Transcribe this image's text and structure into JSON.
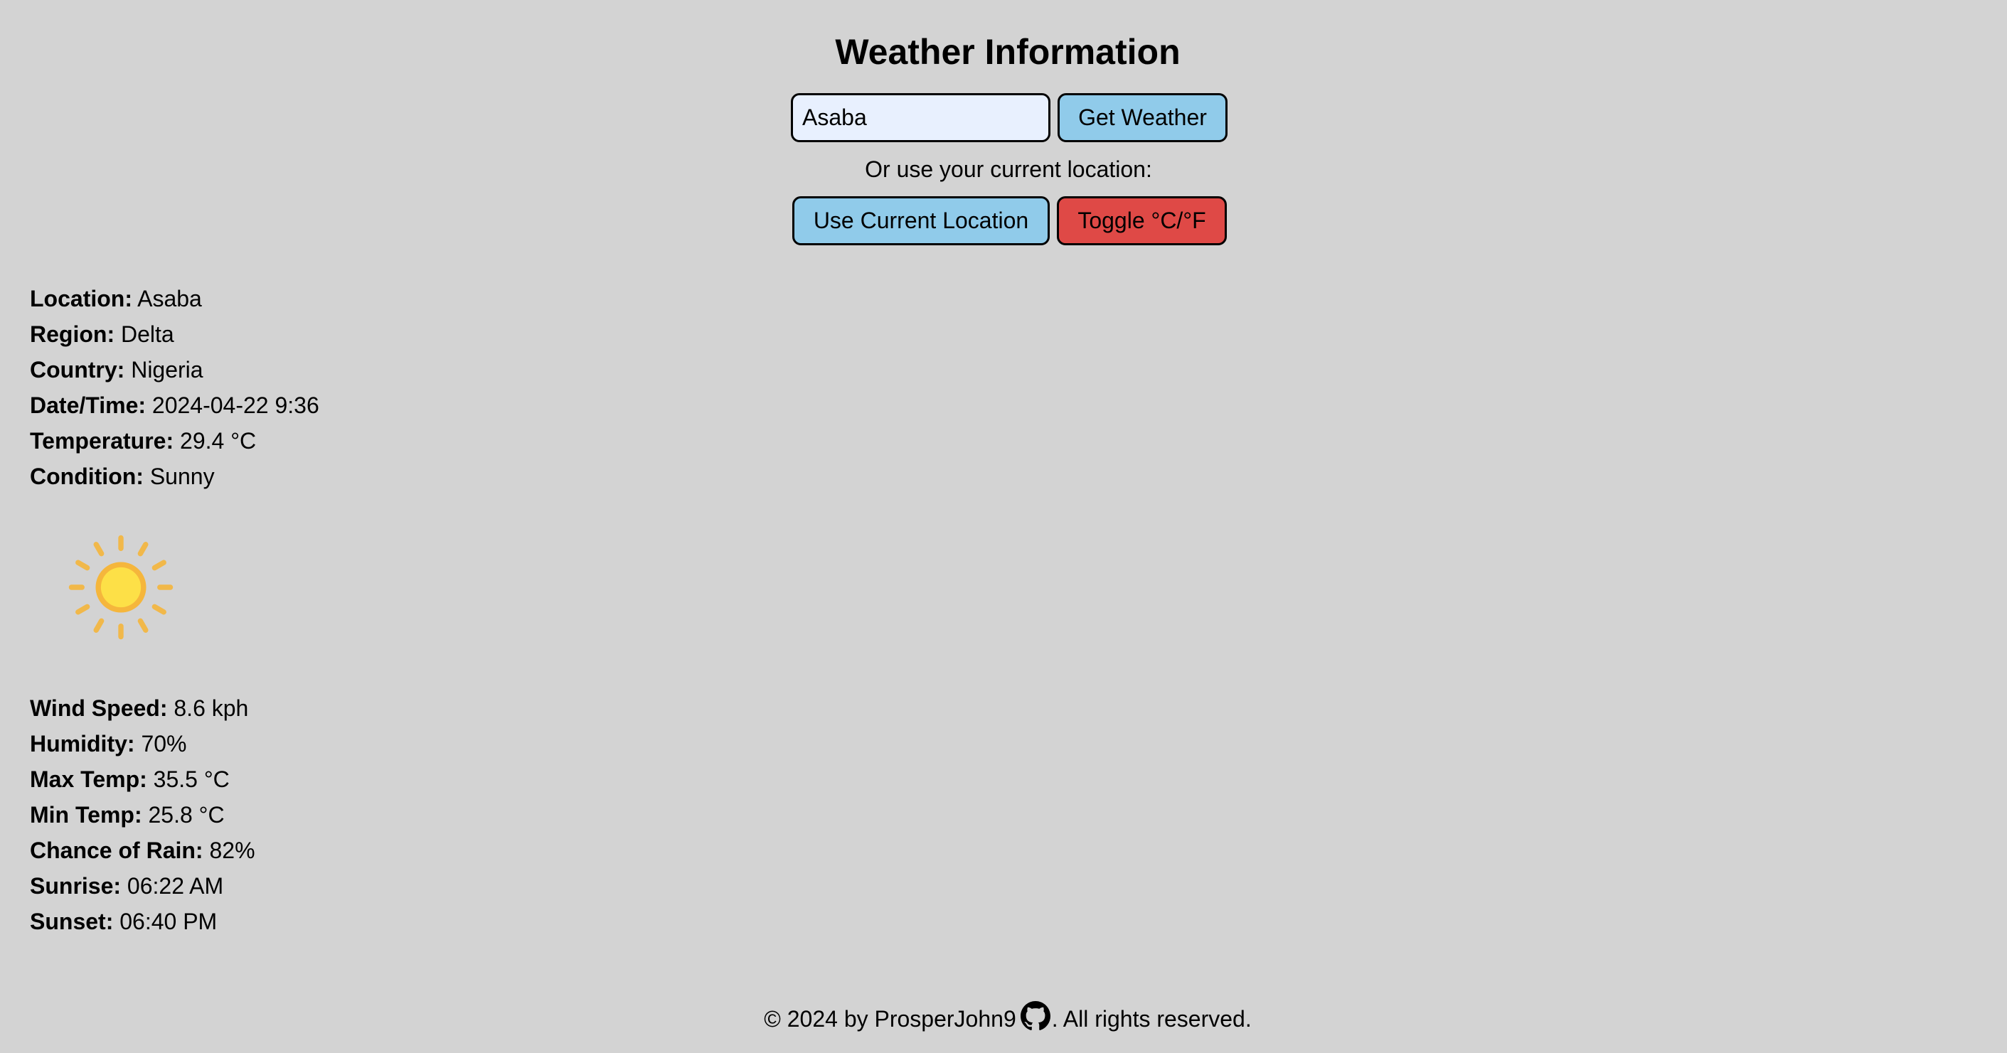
{
  "header": {
    "title": "Weather Information"
  },
  "search": {
    "value": "Asaba",
    "button_label": "Get Weather"
  },
  "location": {
    "prompt": "Or use your current location:",
    "use_location_label": "Use Current Location",
    "toggle_label": "Toggle °C/°F"
  },
  "weather": {
    "primary": [
      {
        "label": "Location:",
        "value": "Asaba"
      },
      {
        "label": "Region:",
        "value": "Delta"
      },
      {
        "label": "Country:",
        "value": "Nigeria"
      },
      {
        "label": "Date/Time:",
        "value": "2024-04-22 9:36"
      },
      {
        "label": "Temperature:",
        "value": "29.4 °C"
      },
      {
        "label": "Condition:",
        "value": "Sunny"
      }
    ],
    "condition_icon": "sun-icon",
    "details": [
      {
        "label": "Wind Speed:",
        "value": "8.6 kph"
      },
      {
        "label": "Humidity:",
        "value": "70%"
      },
      {
        "label": "Max Temp:",
        "value": "35.5 °C"
      },
      {
        "label": "Min Temp:",
        "value": "25.8 °C"
      },
      {
        "label": "Chance of Rain:",
        "value": "82%"
      },
      {
        "label": "Sunrise:",
        "value": "06:22 AM"
      },
      {
        "label": "Sunset:",
        "value": "06:40 PM"
      }
    ]
  },
  "footer": {
    "prefix": "© 2024 by ProsperJohn9",
    "icon": "github-icon",
    "suffix": ". All rights reserved."
  },
  "colors": {
    "background": "#d3d3d3",
    "button_blue": "#90cbea",
    "button_red": "#df4946",
    "input_bg": "#e8f0fe",
    "sun_rays": "#f5b63c",
    "sun_core": "#fde047"
  }
}
